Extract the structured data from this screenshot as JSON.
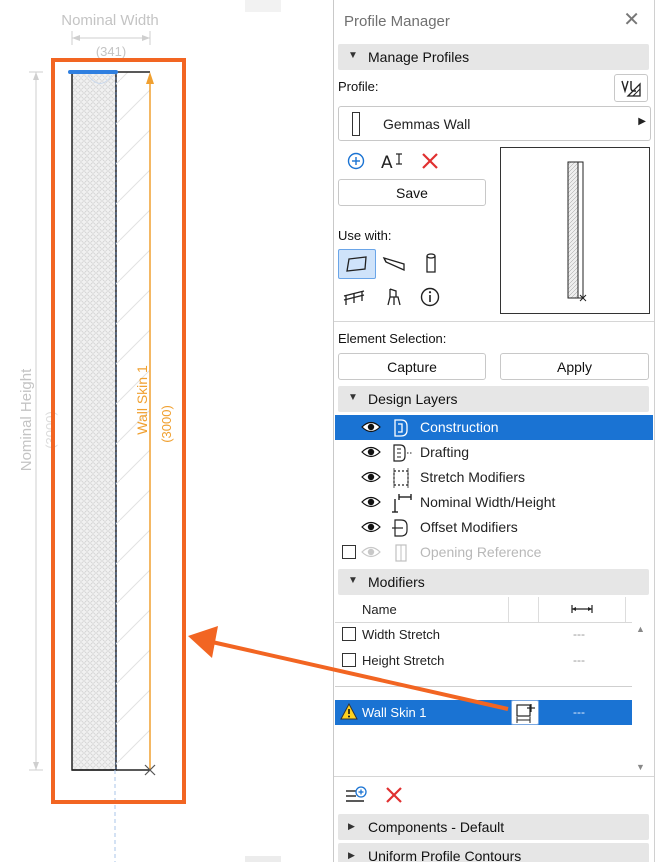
{
  "canvas": {
    "nominal_width_label": "Nominal Width",
    "nominal_width_value": "(341)",
    "nominal_height_label": "Nominal Height",
    "nominal_height_value": "(3000)",
    "skin_label": "Wall Skin 1",
    "skin_value": "(3000)"
  },
  "panel": {
    "title": "Profile Manager",
    "manage_profiles": {
      "header": "Manage Profiles",
      "profile_label": "Profile:",
      "profile_name": "Gemmas Wall",
      "save_label": "Save",
      "use_with_label": "Use with:",
      "element_selection_label": "Element Selection:",
      "capture_label": "Capture",
      "apply_label": "Apply"
    },
    "design_layers": {
      "header": "Design Layers",
      "items": [
        {
          "label": "Construction",
          "icon": "construction-layer-icon"
        },
        {
          "label": "Drafting",
          "icon": "drafting-layer-icon"
        },
        {
          "label": "Stretch Modifiers",
          "icon": "stretch-modifiers-icon"
        },
        {
          "label": "Nominal Width/Height",
          "icon": "nominal-size-icon"
        },
        {
          "label": "Offset Modifiers",
          "icon": "offset-modifiers-icon"
        },
        {
          "label": "Opening Reference",
          "icon": "opening-reference-icon"
        }
      ]
    },
    "modifiers": {
      "header": "Modifiers",
      "column_name": "Name",
      "rows": [
        {
          "name": "Width Stretch",
          "value": "---"
        },
        {
          "name": "Height Stretch",
          "value": "---"
        },
        {
          "name": "Wall Skin 1",
          "value": "---"
        }
      ]
    },
    "components_header": "Components - Default",
    "uniform_header": "Uniform Profile Contours"
  },
  "colors": {
    "accent": "#1a73d3",
    "annotation_orange": "#f26522",
    "skin_orange": "#f0a030",
    "delete_red": "#e03030"
  }
}
